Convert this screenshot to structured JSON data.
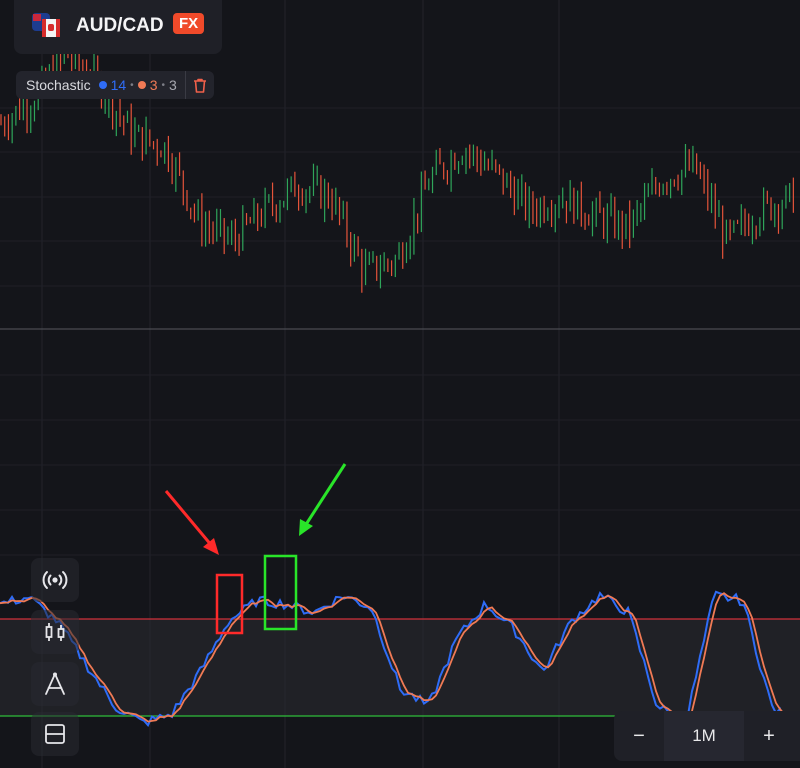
{
  "instrument": {
    "pair": "AUD/CAD",
    "badge": "FX",
    "base_flag_icon": "australia-flag-icon",
    "quote_flag_icon": "canada-flag-icon"
  },
  "indicator": {
    "name": "Stochastic",
    "k_period": "14",
    "k_color": "#2f6cf6",
    "d_period": "3",
    "d_color": "#f07a55",
    "smooth": "3",
    "delete_icon": "trash-icon",
    "overbought_color": "#d0303a",
    "oversold_color": "#2fbe3a"
  },
  "toolbar": {
    "icons": [
      "broadcast-icon",
      "candlestick-icon",
      "drawing-tools-icon",
      "layout-icon"
    ]
  },
  "zoom": {
    "minus": "−",
    "level": "1M",
    "plus": "+"
  },
  "annotations": {
    "red_color": "#ff2a2a",
    "green_color": "#29e529"
  },
  "colors": {
    "background": "#14151a",
    "bull": "#2fa55a",
    "bear": "#e5543a"
  },
  "chart_data": {
    "type": "candlestick",
    "series": [
      {
        "name": "AUD/CAD",
        "close_trend": [
          64,
          68,
          75,
          70,
          62,
          60,
          48,
          45,
          50,
          54,
          52,
          40,
          42,
          55,
          60,
          56,
          50,
          52,
          49,
          47,
          55,
          57,
          45,
          50,
          52
        ]
      },
      {
        "name": "Stochastic",
        "k": [
          80,
          84,
          70,
          45,
          20,
          10,
          15,
          40,
          70,
          82,
          80,
          75,
          85,
          78,
          30,
          20,
          60,
          80,
          65,
          40,
          70,
          85,
          75,
          20,
          10,
          85,
          82,
          20,
          5
        ]
      }
    ]
  }
}
